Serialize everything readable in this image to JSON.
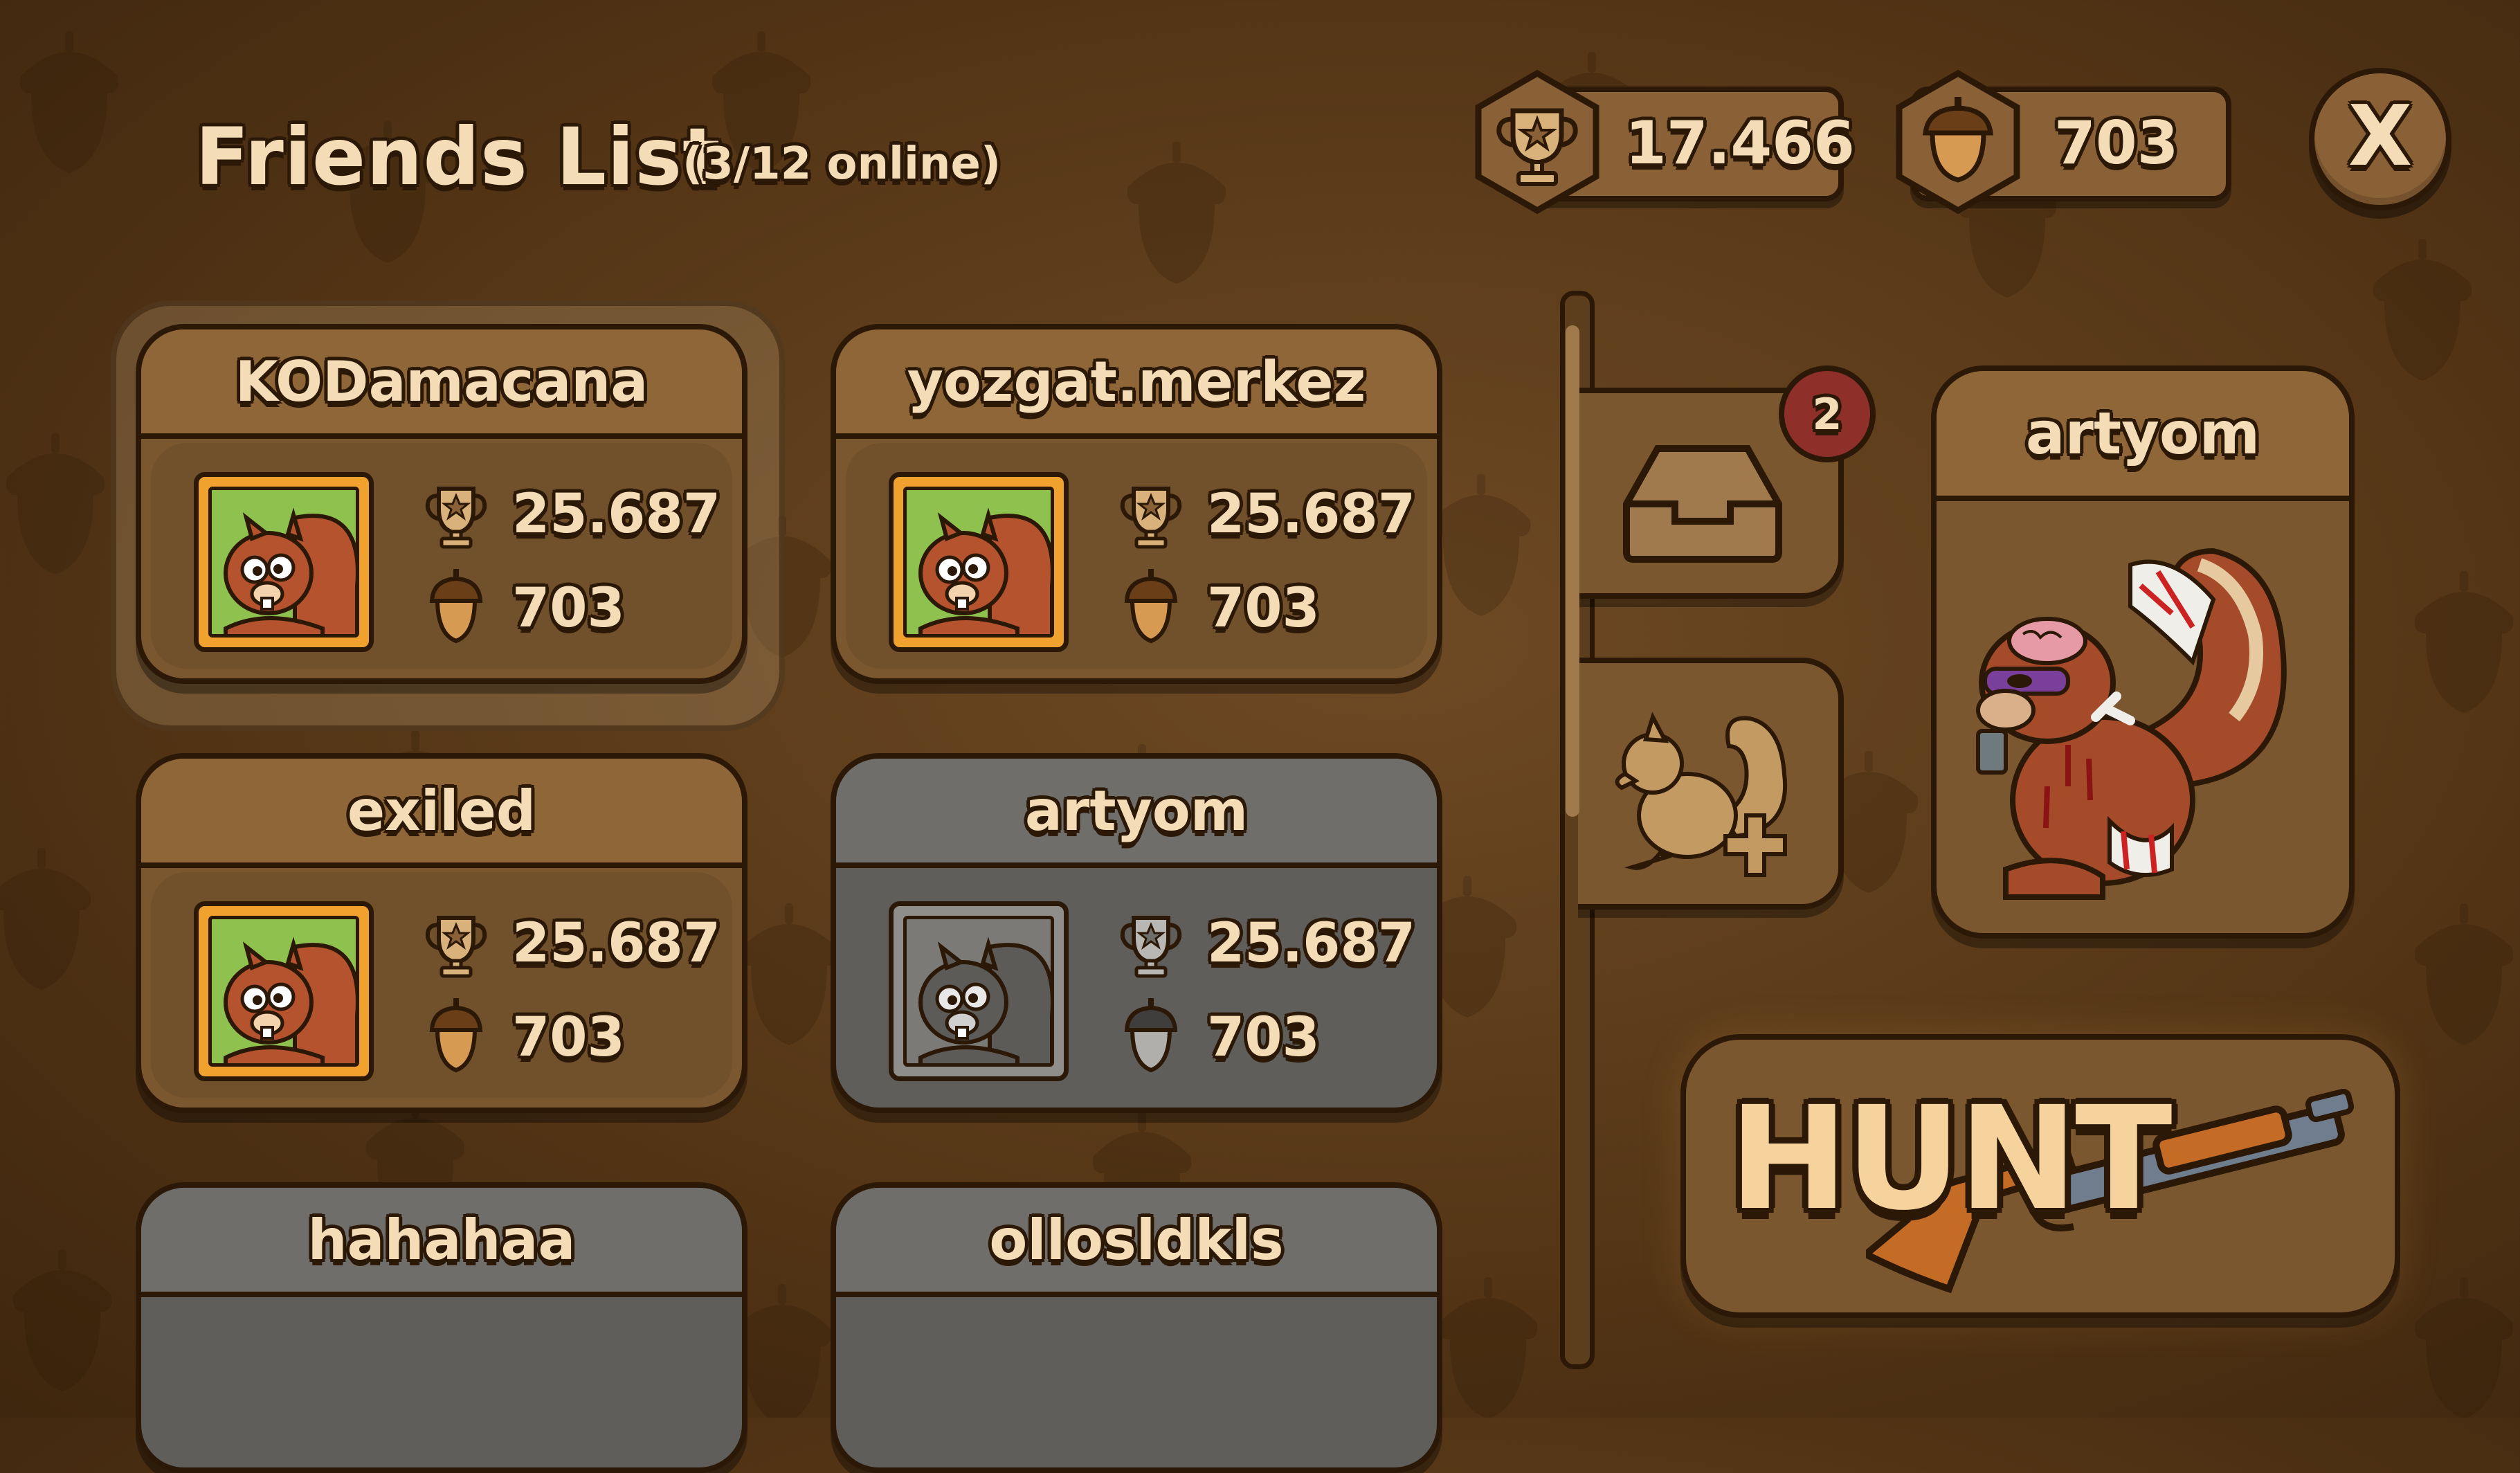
{
  "header": {
    "title": "Friends List",
    "online_status": "(3/12 online)",
    "trophies": "17.466",
    "acorns": "703",
    "close_label": "X"
  },
  "friends": [
    {
      "name": "KODamacana",
      "trophies": "25.687",
      "acorns": "703",
      "online": true,
      "selected": true
    },
    {
      "name": "yozgat.merkez",
      "trophies": "25.687",
      "acorns": "703",
      "online": true,
      "selected": false
    },
    {
      "name": "exiled",
      "trophies": "25.687",
      "acorns": "703",
      "online": true,
      "selected": false
    },
    {
      "name": "artyom",
      "trophies": "25.687",
      "acorns": "703",
      "online": false,
      "selected": false
    },
    {
      "name": "hahahaa",
      "online": false
    },
    {
      "name": "ollosldkls",
      "online": false
    }
  ],
  "side_tabs": {
    "inbox_icon": "inbox-tray-icon",
    "inbox_badge": "2",
    "add_friend_icon": "add-squirrel-icon"
  },
  "profile": {
    "name": "artyom",
    "character": "zombie-squirrel"
  },
  "hunt_button": {
    "label": "HUNT",
    "icon": "shotgun-icon"
  },
  "colors": {
    "panel_brown": "#7b5730",
    "panel_gray": "#5f5e5b",
    "outline": "#2b1807",
    "text": "#f3dcb6",
    "badge_red": "#8f2f2a",
    "avatar_frame_online": "#f0a12e"
  }
}
